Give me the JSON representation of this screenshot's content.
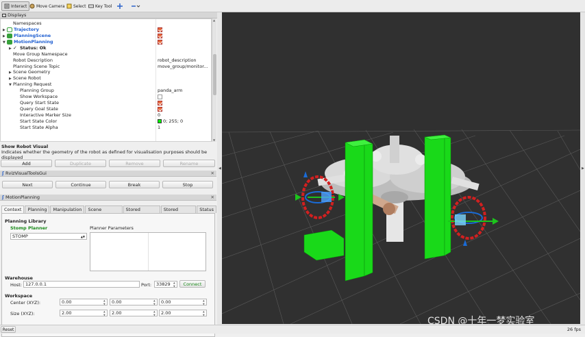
{
  "toolbar": {
    "items": [
      {
        "label": "Interact",
        "icon": "interact-icon"
      },
      {
        "label": "Move Camera",
        "icon": "move-camera-icon"
      },
      {
        "label": "Select",
        "icon": "select-icon"
      },
      {
        "label": "Key Tool",
        "icon": "key-tool-icon"
      }
    ],
    "extra_icons": [
      "crosshair-icon",
      "minus-dropdown-icon"
    ]
  },
  "displays": {
    "title": "Displays",
    "rows": [
      {
        "label": "Namespaces",
        "value": ""
      },
      {
        "label": "Trajectory",
        "value": "checked"
      },
      {
        "label": "PlanningScene",
        "value": "checked"
      },
      {
        "label": "MotionPlanning",
        "value": "checked"
      },
      {
        "label": "Status: Ok",
        "value": ""
      },
      {
        "label": "Move Group Namespace",
        "value": ""
      },
      {
        "label": "Robot Description",
        "value": "robot_description"
      },
      {
        "label": "Planning Scene Topic",
        "value": "move_group/monitor..."
      },
      {
        "label": "Scene Geometry",
        "value": ""
      },
      {
        "label": "Scene Robot",
        "value": ""
      },
      {
        "label": "Planning Request",
        "value": ""
      },
      {
        "label": "Planning Group",
        "value": "panda_arm"
      },
      {
        "label": "Show Workspace",
        "value": "unchecked"
      },
      {
        "label": "Query Start State",
        "value": "checked"
      },
      {
        "label": "Query Goal State",
        "value": "checked"
      },
      {
        "label": "Interactive Marker Size",
        "value": "0"
      },
      {
        "label": "Start State Color",
        "value": "0; 255; 0"
      },
      {
        "label": "Start State Alpha",
        "value": "1"
      }
    ],
    "description_title": "Show Robot Visual",
    "description_text": "Indicates whether the geometry of the robot as defined for visualisation purposes should be displayed",
    "buttons": [
      "Add",
      "Duplicate",
      "Remove",
      "Rename"
    ]
  },
  "rviz_tools": {
    "title": "RvizVisualToolsGui",
    "buttons": [
      "Next",
      "Continue",
      "Break",
      "Stop"
    ]
  },
  "motion_planning": {
    "title": "MotionPlanning",
    "tabs": [
      "Context",
      "Planning",
      "Manipulation",
      "Scene Objects",
      "Stored Scenes",
      "Stored States",
      "Status"
    ],
    "planning_library_label": "Planning Library",
    "planner_name": "Stomp Planner",
    "planner_select": "STOMP",
    "planner_params_label": "Planner Parameters",
    "warehouse_label": "Warehouse",
    "host_label": "Host:",
    "host_value": "127.0.0.1",
    "port_label": "Port:",
    "port_value": "33829",
    "connect_label": "Connect",
    "workspace_label": "Workspace",
    "center_label": "Center (XYZ):",
    "center_values": [
      "0.00",
      "0.00",
      "0.00"
    ],
    "size_label": "Size (XYZ):",
    "size_values": [
      "2.00",
      "2.00",
      "2.00"
    ]
  },
  "status_bar": {
    "reset_label": "Reset",
    "fps": "26 fps"
  },
  "watermark": "CSDN @十年一梦实验室",
  "colors": {
    "viewport_bg": "#303030",
    "obstacle_green": "#19d919",
    "check_orange": "#e86a3a",
    "link_blue": "#1f5fd1",
    "start_state_swatch": "#00ff00"
  }
}
